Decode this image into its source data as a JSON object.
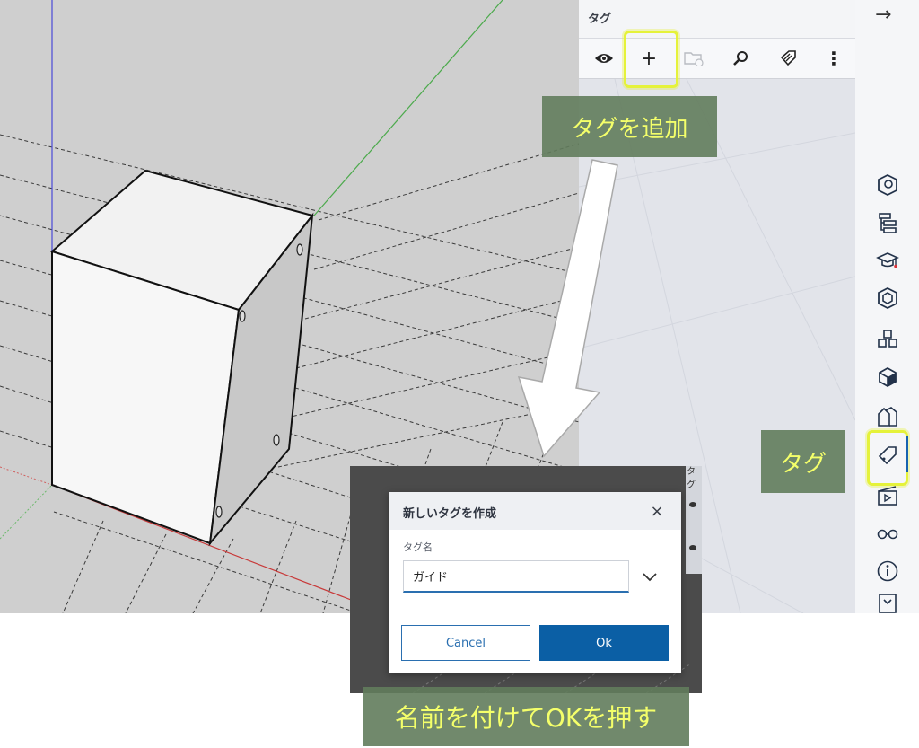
{
  "panel": {
    "title": "タグ",
    "toolbar": [
      {
        "icon": "eye-icon"
      },
      {
        "icon": "plus-icon",
        "label": "+"
      },
      {
        "icon": "folder-add-icon"
      },
      {
        "icon": "search-icon"
      },
      {
        "icon": "tag-color-icon"
      },
      {
        "icon": "more-icon",
        "label": "⋮"
      }
    ]
  },
  "side_rail": {
    "collapse_arrow": "→",
    "icons": [
      "entity-info-icon",
      "outliner-icon",
      "instructor-icon",
      "materials-icon",
      "components-icon",
      "styles-icon",
      "scenes-icon",
      "tags-icon",
      "animation-icon",
      "display-icon",
      "info-icon",
      "solid-inspector-icon"
    ]
  },
  "callouts": {
    "add_tag": "タグを追加",
    "tag": "タグ",
    "name_and_ok": "名前を付けてOKを押す"
  },
  "dialog": {
    "title": "新しいタグを作成",
    "close": "×",
    "field_label": "タグ名",
    "input_value": "ガイド",
    "cancel": "Cancel",
    "ok": "Ok",
    "background_panel_title": "タグ"
  },
  "colors": {
    "highlight": "#e5f23a",
    "callout_bg": "#627c5c",
    "callout_text": "#f4ff6a",
    "primary": "#0b5fa5"
  }
}
